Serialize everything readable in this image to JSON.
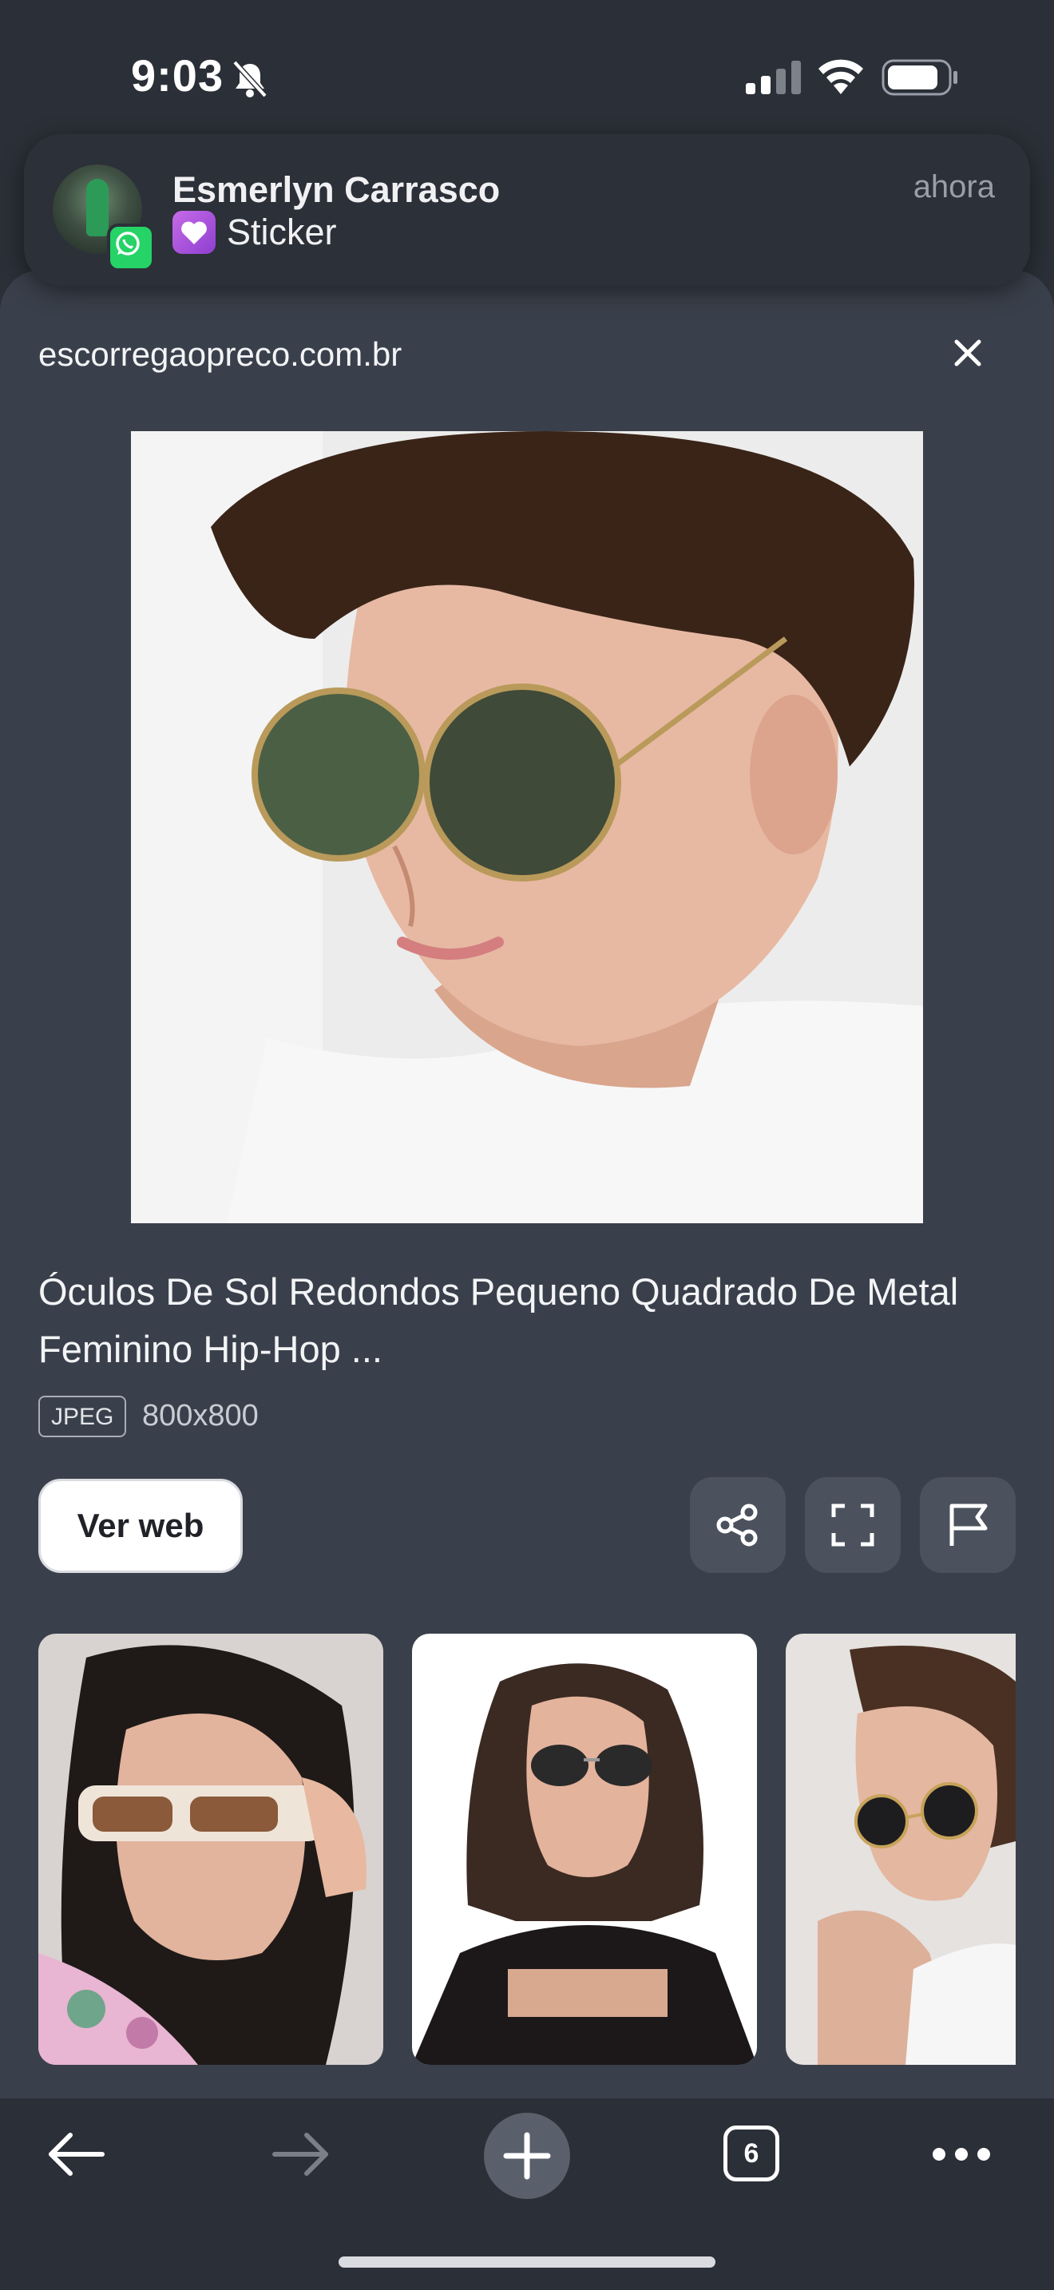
{
  "status_bar": {
    "time": "9:03",
    "icons": [
      "bell-slash-icon",
      "cellular-signal-icon",
      "wifi-icon",
      "battery-icon"
    ]
  },
  "notification": {
    "app": "whatsapp-icon",
    "sender": "Esmerlyn Carrasco",
    "message": "Sticker",
    "time": "ahora",
    "message_icon": "heart-icon"
  },
  "viewer": {
    "domain": "escorregaopreco.com.br",
    "close_icon": "close-icon",
    "title": "Óculos De Sol Redondos Pequeno Quadrado De Metal Feminino Hip-Hop ...",
    "format": "JPEG",
    "dimensions": "800x800",
    "ver_web_label": "Ver web",
    "actions": [
      "share-icon",
      "fullscreen-icon",
      "flag-icon"
    ]
  },
  "bottom_nav": {
    "tabs_count": "6",
    "icons": [
      "back-arrow-icon",
      "forward-arrow-icon",
      "plus-icon",
      "tabs-icon",
      "more-icon"
    ]
  },
  "colors": {
    "background": "#2b2f37",
    "sheet": "#3a404b",
    "button_gray": "#4b525e",
    "whatsapp_green": "#25d366"
  }
}
